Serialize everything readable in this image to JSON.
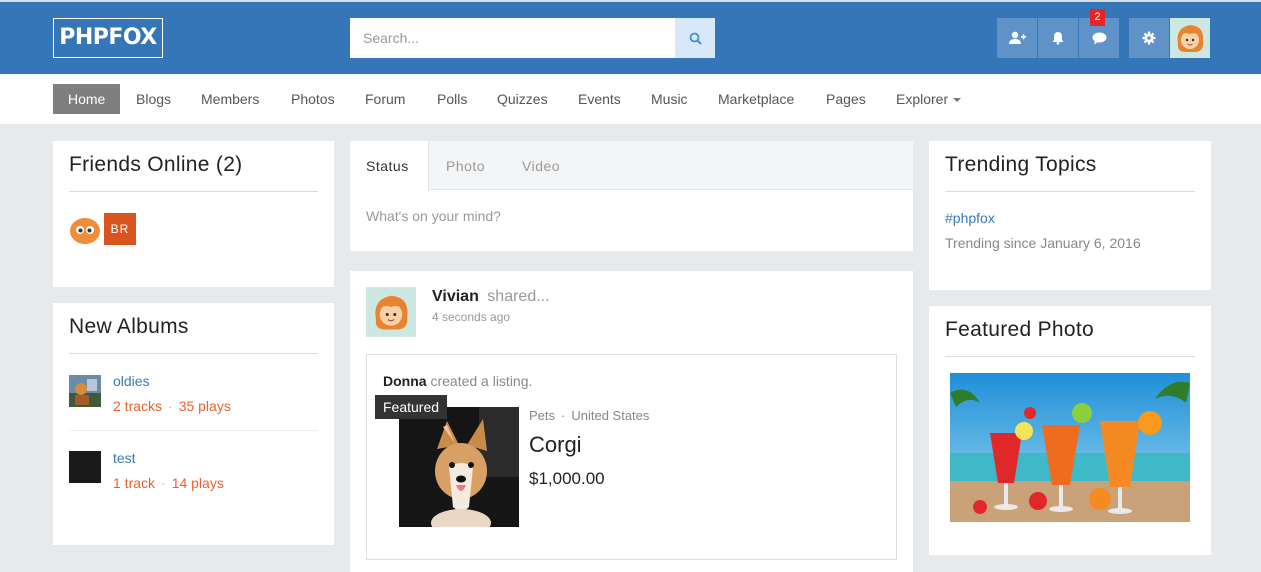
{
  "header": {
    "logo": "PHPFOX",
    "search_placeholder": "Search...",
    "message_badge": "2",
    "icons": [
      "add-friend-icon",
      "bell-icon",
      "chat-icon",
      "gear-icon"
    ]
  },
  "nav": {
    "items": [
      "Home",
      "Blogs",
      "Members",
      "Photos",
      "Forum",
      "Polls",
      "Quizzes",
      "Events",
      "Music",
      "Marketplace",
      "Pages",
      "Explorer"
    ]
  },
  "friends_online": {
    "title": "Friends Online (2)",
    "avatar2_initials": "BR"
  },
  "new_albums": {
    "title": "New Albums",
    "albums": [
      {
        "name": "oldies",
        "tracks": "2 tracks",
        "plays": "35 plays"
      },
      {
        "name": "test",
        "tracks": "1 track",
        "plays": "14 plays"
      }
    ]
  },
  "composer": {
    "tabs": [
      "Status",
      "Photo",
      "Video"
    ],
    "placeholder": "What's on your mind?"
  },
  "feed": {
    "author": "Vivian",
    "action": "shared...",
    "time": "4 seconds ago",
    "shared": {
      "user": "Donna",
      "action": "created a listing.",
      "badge": "Featured",
      "category": "Pets",
      "location": "United States",
      "title": "Corgi",
      "price": "$1,000.00"
    }
  },
  "trending": {
    "title": "Trending Topics",
    "tag": "#phpfox",
    "since": "Trending since January 6, 2016"
  },
  "featured_photo": {
    "title": "Featured Photo"
  },
  "colors": {
    "header_bg": "#3476b8",
    "link": "#3a78b8",
    "accent_orange": "#e8632c",
    "badge_red": "#e32525",
    "nav_active": "#7f7f7f"
  }
}
